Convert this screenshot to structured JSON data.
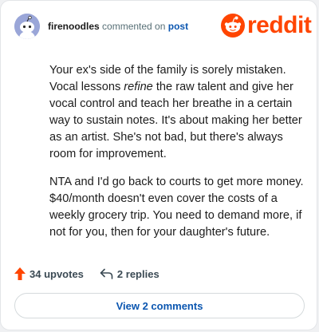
{
  "header": {
    "username": "firenoodles",
    "action_text": "commented on",
    "post_link": "post"
  },
  "logo": {
    "wordmark": "reddit",
    "icon": "reddit-snoo-icon",
    "brand_color": "#ff4500"
  },
  "comment": {
    "p1_before": "Your ex's side of the family is sorely mistaken. Vocal lessons ",
    "p1_emphasis": "refine",
    "p1_after": " the raw talent and give her vocal control and teach her breathe in a certain way to sustain notes. It's about making her better as an artist. She's not bad, but there's always room for improvement.",
    "p2": "NTA and I'd go back to courts to get more money. $40/month doesn't even cover the costs of a weekly grocery trip. You need to demand more, if not for you, then for your daughter's future."
  },
  "actions": {
    "upvotes_label": "34 upvotes",
    "upvote_icon": "upvote-arrow-icon",
    "upvote_color": "#ff4500",
    "replies_label": "2 replies",
    "reply_icon": "reply-arrow-icon"
  },
  "footer": {
    "view_comments_label": "View 2 comments",
    "link_color": "#0b56b0"
  }
}
